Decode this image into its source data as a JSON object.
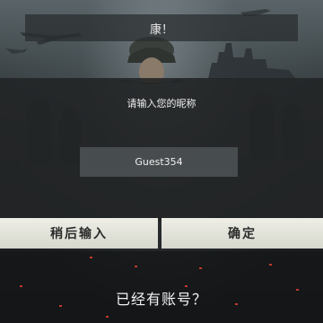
{
  "banner": {
    "text": "康！"
  },
  "dialog": {
    "prompt": "请输入您的昵称",
    "nickname_value": "Guest354"
  },
  "buttons": {
    "later_label": "稍后输入",
    "confirm_label": "确定"
  },
  "footer": {
    "have_account_link": "已经有账号？"
  },
  "colors": {
    "button_bg": "#e2e3da",
    "dialog_bg": "#222526",
    "input_bg": "#4a4e50",
    "ember": "#c0392b"
  }
}
